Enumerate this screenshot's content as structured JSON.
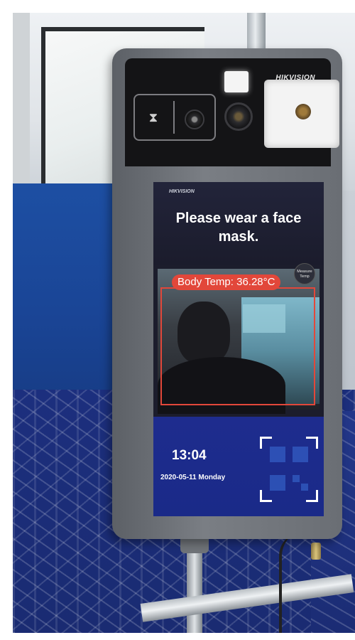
{
  "device": {
    "brand_top": "HIKVISION",
    "screen_brand": "HIKVISION",
    "message": "Please wear a face mask.",
    "temperature": "Body Temp: 36.28°C",
    "mode_badge": "Measure Temp",
    "time": "13:04",
    "date": "2020-05-11 Monday"
  },
  "colors": {
    "alert_red": "#e2473a",
    "screen_bottom_blue": "#1e2c8e"
  },
  "icons": [
    "ir-sensor-icon",
    "camera-lens-icon",
    "qr-code-icon"
  ]
}
